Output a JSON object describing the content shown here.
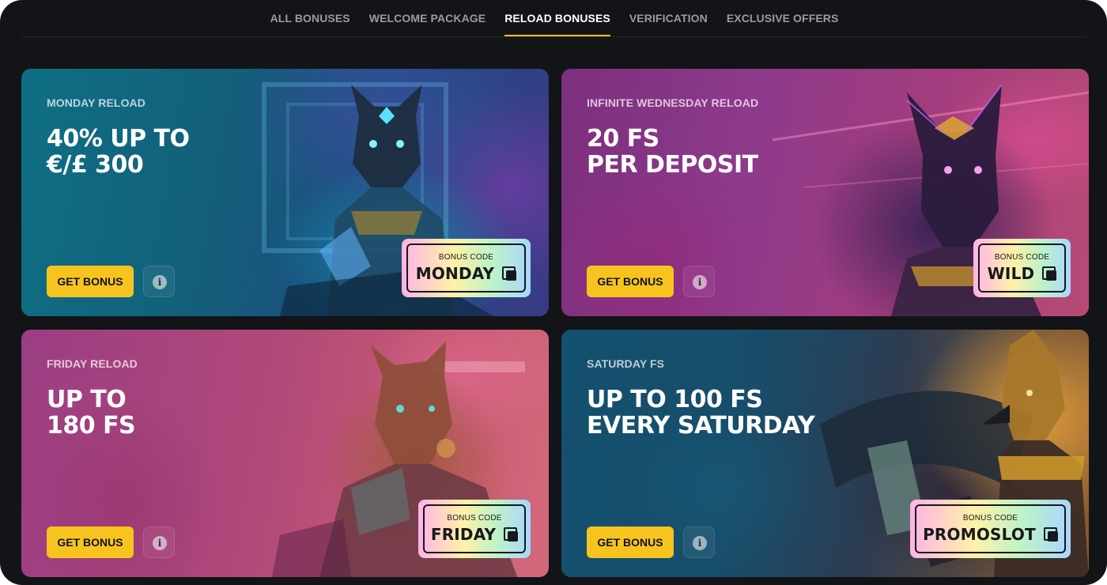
{
  "tabs": [
    {
      "label": "ALL BONUSES",
      "active": false
    },
    {
      "label": "WELCOME PACKAGE",
      "active": false
    },
    {
      "label": "RELOAD BONUSES",
      "active": true
    },
    {
      "label": "VERIFICATION",
      "active": false
    },
    {
      "label": "EXCLUSIVE OFFERS",
      "active": false
    }
  ],
  "colors": {
    "accent": "#f7c41f",
    "background": "#131418",
    "tab_inactive": "#9a9ba3",
    "tab_active": "#ffffff"
  },
  "cards": [
    {
      "eyebrow": "MONDAY RELOAD",
      "headline": [
        "40% UP TO",
        "€/£ 300"
      ],
      "button": "GET BONUS",
      "info_icon": "i",
      "code_label": "BONUS CODE",
      "code": "MONDAY"
    },
    {
      "eyebrow": "INFINITE WEDNESDAY RELOAD",
      "headline": [
        "20 FS",
        "PER DEPOSIT"
      ],
      "button": "GET BONUS",
      "info_icon": "i",
      "code_label": "BONUS CODE",
      "code": "WILD"
    },
    {
      "eyebrow": "FRIDAY RELOAD",
      "headline": [
        "UP TO",
        "180 FS"
      ],
      "button": "GET BONUS",
      "info_icon": "i",
      "code_label": "BONUS CODE",
      "code": "FRIDAY"
    },
    {
      "eyebrow": "SATURDAY FS",
      "headline": [
        "UP TO 100 FS",
        "EVERY SATURDAY"
      ],
      "button": "GET BONUS",
      "info_icon": "i",
      "code_label": "BONUS CODE",
      "code": "PROMOSLOT"
    }
  ]
}
